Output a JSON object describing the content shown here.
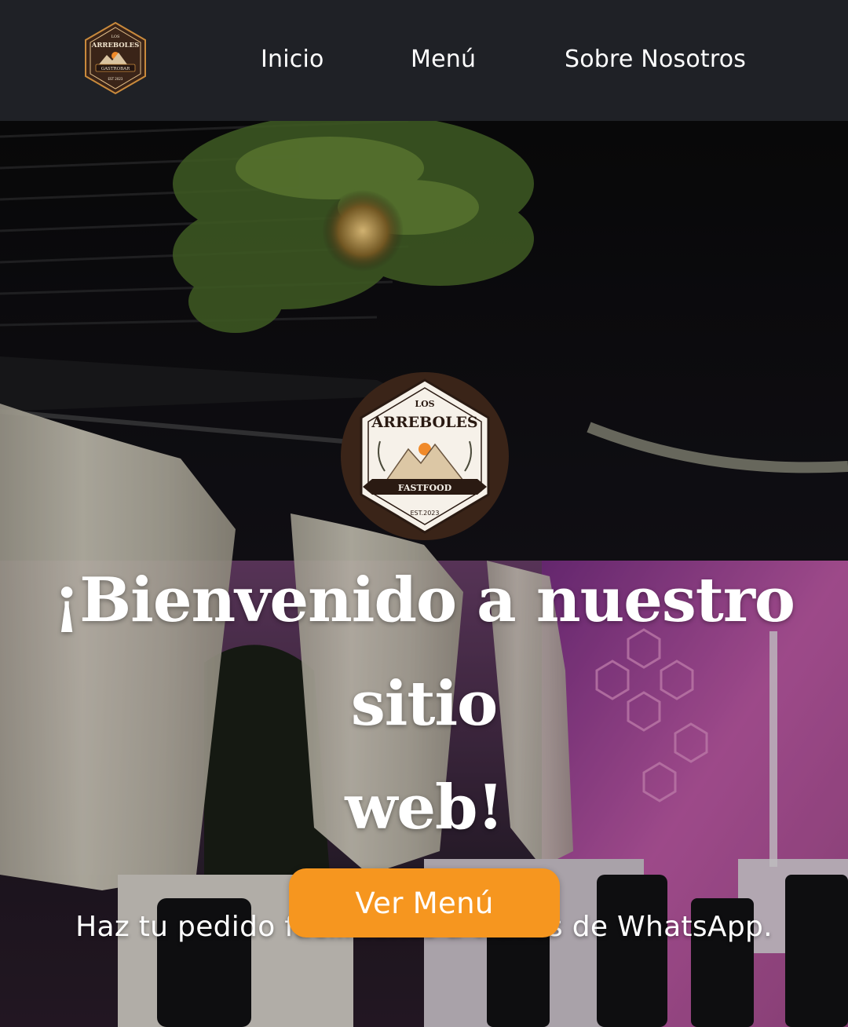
{
  "header": {
    "logo": {
      "icon": "los-arreboles-logo",
      "top_text": "LOS",
      "brand": "ARREBOLES",
      "ribbon": "GASTROBAR",
      "est": "EST 2023"
    },
    "nav": [
      {
        "label": "Inicio"
      },
      {
        "label": "Menú"
      },
      {
        "label": "Sobre Nosotros"
      }
    ]
  },
  "hero": {
    "background": "restaurant-patio-night-photo",
    "logo": {
      "icon": "los-arreboles-fastfood-logo",
      "top_text": "LOS",
      "brand": "ARREBOLES",
      "ribbon": "FASTFOOD",
      "est": "EST.2023"
    },
    "title_line1": "¡Bienvenido a nuestro sitio",
    "title_line2": "web!",
    "subtitle": "Haz tu pedido fácilmente a través de WhatsApp.",
    "cta_label": "Ver Menú"
  },
  "colors": {
    "header_bg": "#1f2126",
    "accent": "#f6961f",
    "text": "#ffffff",
    "logo_brown": "#3a2418"
  }
}
